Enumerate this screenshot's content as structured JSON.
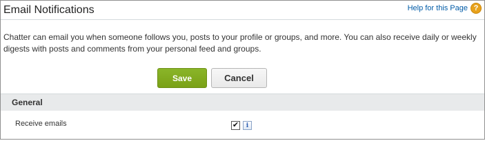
{
  "header": {
    "title": "Email Notifications",
    "help_link": "Help for this Page",
    "help_icon_glyph": "?"
  },
  "description": "Chatter can email you when someone follows you, posts to your profile or groups, and more. You can also receive daily or weekly digests with posts and comments from your personal feed and groups.",
  "actions": {
    "save_label": "Save",
    "cancel_label": "Cancel"
  },
  "sections": [
    {
      "title": "General",
      "fields": [
        {
          "label": "Receive emails",
          "checked": true,
          "check_glyph": "✔",
          "info_glyph": "i"
        }
      ]
    }
  ],
  "colors": {
    "save_button": "#7aa117",
    "help_icon": "#e8a21b",
    "link": "#015ba7",
    "section_header_bg": "#e8eaeb"
  }
}
